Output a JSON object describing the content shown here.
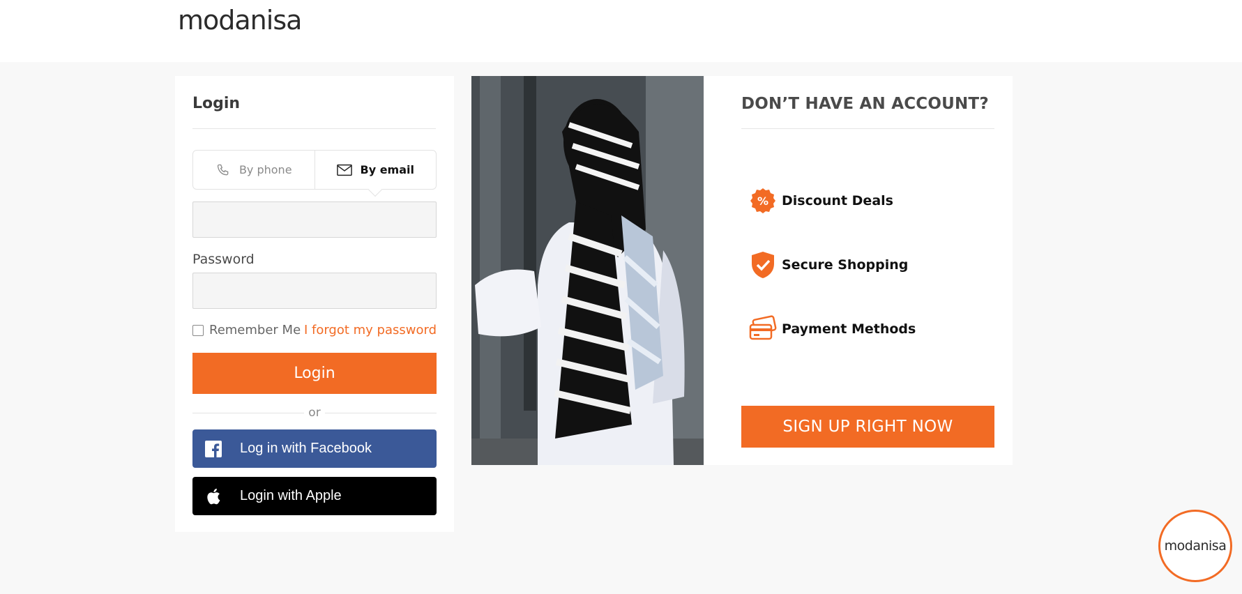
{
  "header": {
    "logo_text": "modanisa"
  },
  "login": {
    "title": "Login",
    "tabs": [
      {
        "label": "By phone",
        "icon": "phone-icon",
        "active": false
      },
      {
        "label": "By email",
        "icon": "envelope-icon",
        "active": true
      }
    ],
    "email_value": "",
    "password_label": "Password",
    "password_value": "",
    "remember_label": "Remember Me",
    "remember_checked": false,
    "forgot_label": "I forgot my password",
    "submit_label": "Login",
    "or_label": "or",
    "facebook_label": "Log in with Facebook",
    "apple_label": "Login with Apple"
  },
  "promo": {
    "title": "DON’T HAVE AN ACCOUNT?",
    "features": [
      {
        "label": "Discount Deals",
        "icon": "percent-badge-icon"
      },
      {
        "label": "Secure Shopping",
        "icon": "shield-check-icon"
      },
      {
        "label": "Payment Methods",
        "icon": "credit-cards-icon"
      }
    ],
    "signup_label": "SIGN UP RIGHT NOW"
  },
  "chat": {
    "logo_text": "modanisa"
  },
  "colors": {
    "accent": "#f26b24",
    "facebook": "#3b5998",
    "apple": "#000000",
    "page_bg": "#f8f8f8"
  }
}
